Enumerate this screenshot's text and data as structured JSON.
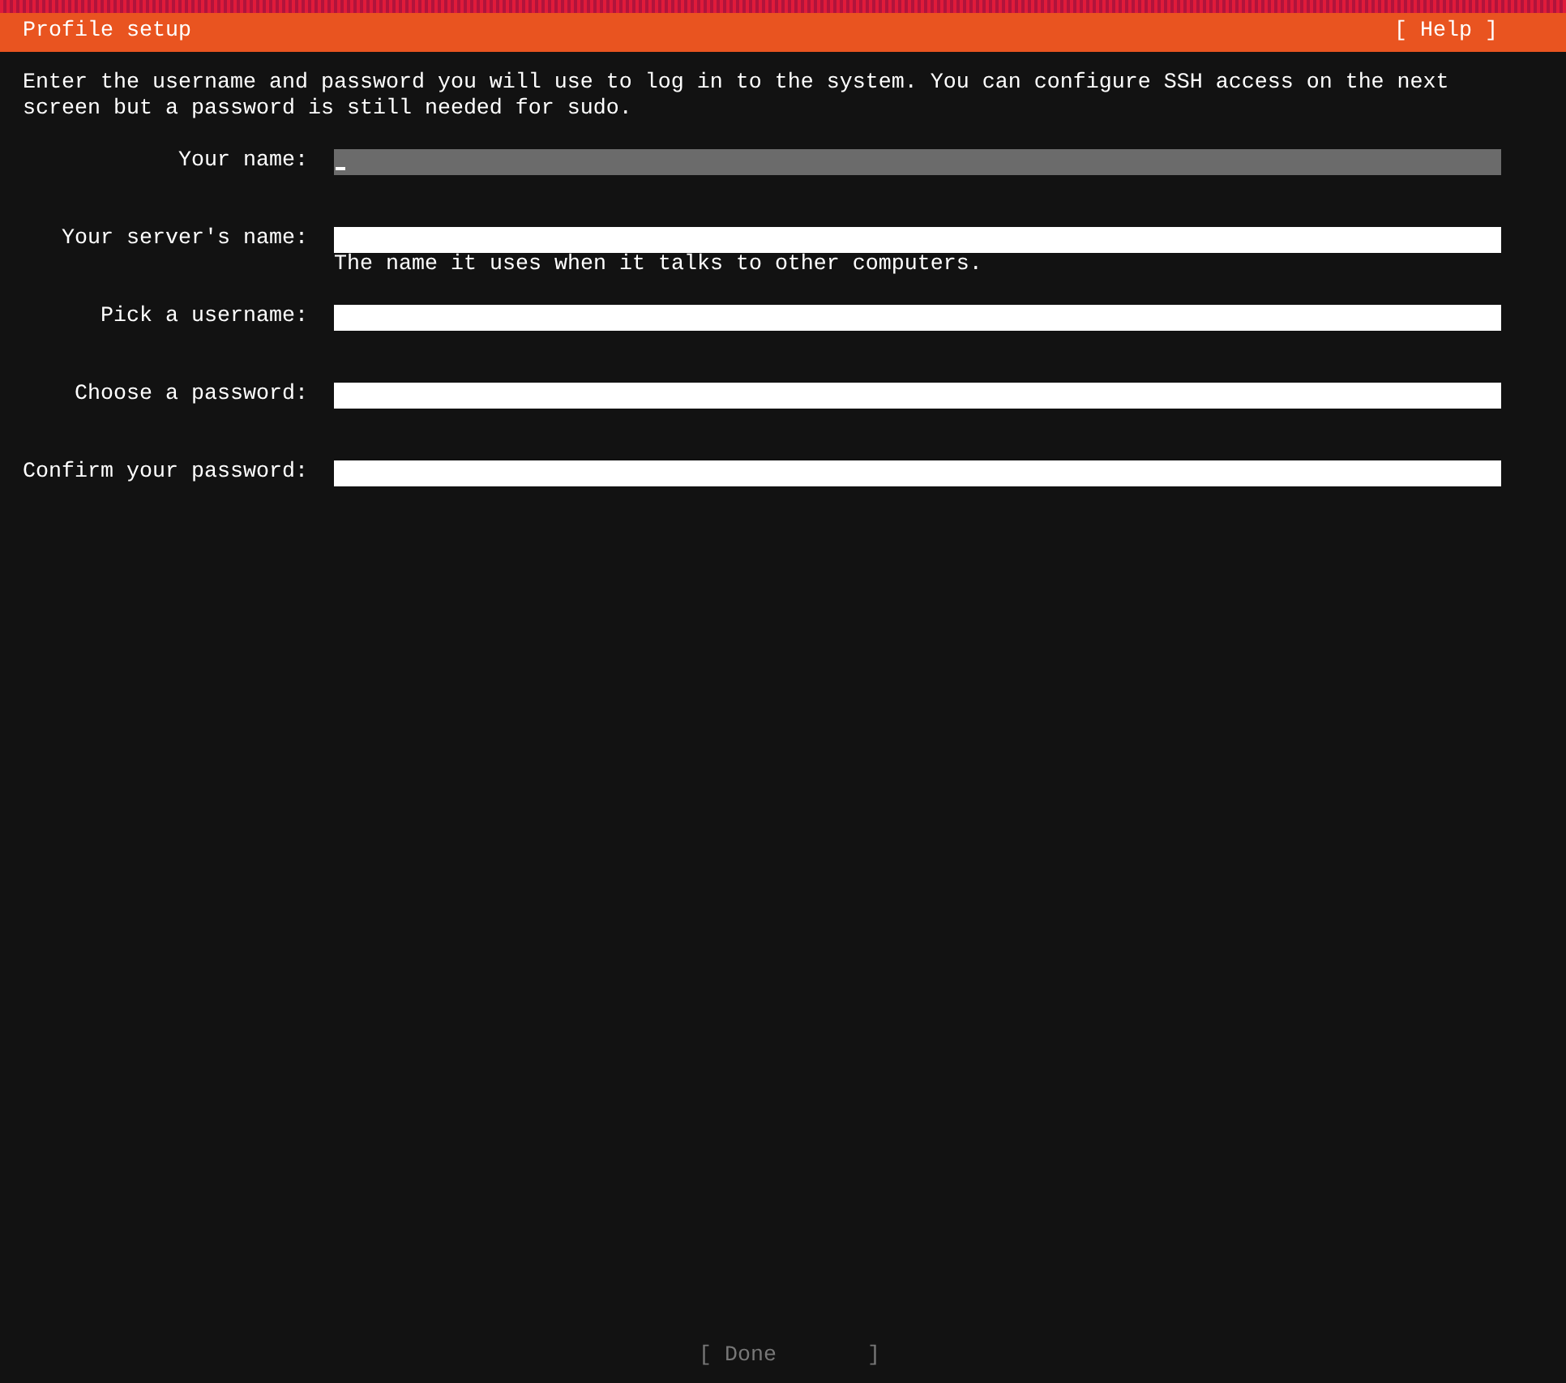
{
  "header": {
    "title": "Profile setup",
    "help_button": "[ Help ]"
  },
  "intro": "Enter the username and password you will use to log in to the system. You can configure SSH access on the next screen but a password is still needed for sudo.",
  "fields": [
    {
      "label": "Your name:",
      "focused": true
    },
    {
      "label": "Your server's name:",
      "focused": false,
      "hint": "The name it uses when it talks to other computers."
    },
    {
      "label": "Pick a username:",
      "focused": false
    },
    {
      "label": "Choose a password:",
      "focused": false
    },
    {
      "label": "Confirm your password:",
      "focused": false
    }
  ],
  "done_button": {
    "label": "[ Done       ]",
    "disabled": true
  }
}
